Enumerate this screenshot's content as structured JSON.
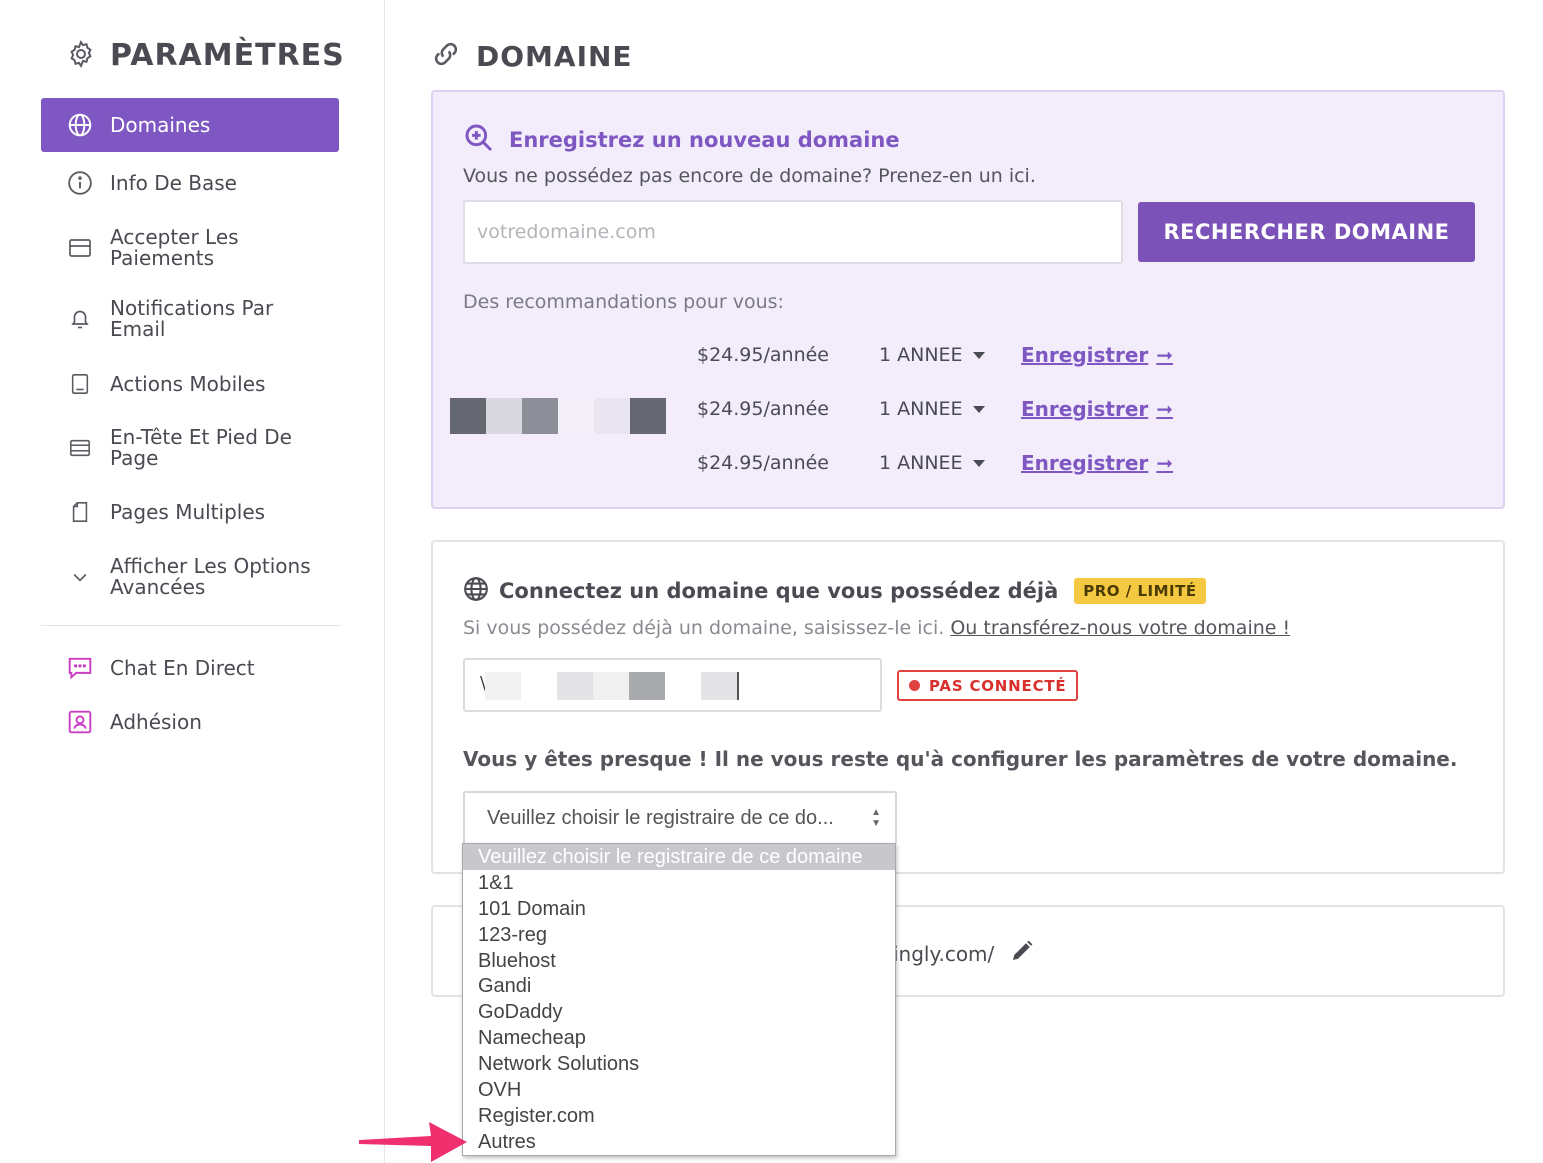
{
  "sidebar": {
    "title": "PARAMÈTRES",
    "items": [
      {
        "label": "Domaines",
        "icon": "globe-icon"
      },
      {
        "label": "Info De Base",
        "icon": "info-icon"
      },
      {
        "label": "Accepter Les Paiements",
        "icon": "credit-card-icon"
      },
      {
        "label": "Notifications Par Email",
        "icon": "bell-icon"
      },
      {
        "label": "Actions Mobiles",
        "icon": "tablet-icon"
      },
      {
        "label": "En-Tête Et Pied De Page",
        "icon": "layout-icon"
      },
      {
        "label": "Pages Multiples",
        "icon": "pages-icon"
      },
      {
        "label": "Afficher Les Options Avancées",
        "icon": "chevron-down-icon"
      }
    ],
    "extra_items": [
      {
        "label": "Chat En Direct",
        "icon": "chat-icon"
      },
      {
        "label": "Adhésion",
        "icon": "member-icon"
      }
    ]
  },
  "main": {
    "title": "DOMAINE",
    "register": {
      "heading": "Enregistrez un nouveau domaine",
      "subtitle": "Vous ne possédez pas encore de domaine? Prenez-en un ici.",
      "placeholder": "votredomaine.com",
      "button": "RECHERCHER DOMAINE",
      "recommend_label": "Des recommandations pour vous:",
      "recommendations": [
        {
          "price": "$24.95/année",
          "period": "1 ANNEE",
          "action": "Enregistrer"
        },
        {
          "price": "$24.95/année",
          "period": "1 ANNEE",
          "action": "Enregistrer"
        },
        {
          "price": "$24.95/année",
          "period": "1 ANNEE",
          "action": "Enregistrer"
        }
      ]
    },
    "connect": {
      "heading": "Connectez un domaine que vous possédez déjà",
      "badge": "PRO / LIMITÉ",
      "subtitle": "Si vous possédez déjà un domaine, saisissez-le ici.",
      "transfer_link": "Ou transférez-nous votre domaine !",
      "input_prefix": "\\",
      "status": "PAS CONNECTÉ",
      "almost": "Vous y êtes presque ! Il ne vous reste qu'à configurer les paramètres de votre domaine.",
      "select_value": "Veuillez choisir le registraire de ce do..."
    },
    "url": {
      "text": "ingly.com/"
    },
    "registrar_options": [
      "Veuillez choisir le registraire de ce domaine",
      "1&1",
      "101 Domain",
      "123-reg",
      "Bluehost",
      "Gandi",
      "GoDaddy",
      "Namecheap",
      "Network Solutions",
      "OVH",
      "Register.com",
      "Autres"
    ]
  },
  "colors": {
    "accent": "#7e57c2",
    "accent_bg": "#f2ecfb",
    "badge_yellow": "#f5c842",
    "status_red": "#e0433f",
    "annotation_arrow": "#f0306e"
  }
}
